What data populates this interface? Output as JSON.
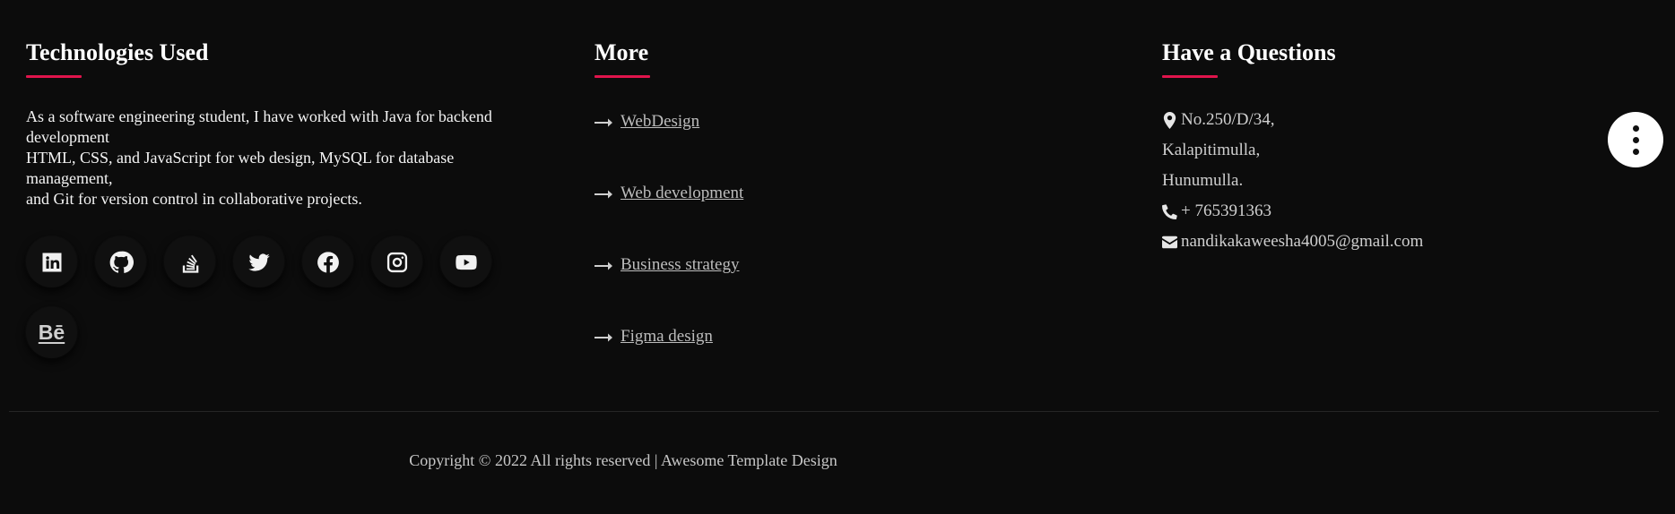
{
  "tech": {
    "heading": "Technologies Used",
    "about_lines": [
      "As a software engineering student, I have worked with Java for backend development",
      "HTML, CSS, and JavaScript for web design, MySQL for database management,",
      "and Git for version control in collaborative projects."
    ],
    "socials": [
      {
        "icon": "linkedin-icon"
      },
      {
        "icon": "github-icon"
      },
      {
        "icon": "stackoverflow-icon"
      },
      {
        "icon": "twitter-icon"
      },
      {
        "icon": "facebook-icon"
      },
      {
        "icon": "instagram-icon"
      },
      {
        "icon": "youtube-icon"
      },
      {
        "icon": "behance-icon",
        "label": "Bē"
      }
    ]
  },
  "more": {
    "heading": "More",
    "links": [
      "WebDesign",
      "Web development",
      "Business strategy",
      "Figma design"
    ]
  },
  "contact": {
    "heading": "Have a Questions",
    "address_lines": [
      "No.250/D/34,",
      "Kalapitimulla,",
      "Hunumulla."
    ],
    "phone": "+ 765391363",
    "email": "nandikakaweesha4005@gmail.com"
  },
  "footer": {
    "copyright": "Copyright © 2022 All rights reserved | Awesome Template Design"
  },
  "colors": {
    "background": "#0c0c0c",
    "accent": "#e0144c"
  }
}
